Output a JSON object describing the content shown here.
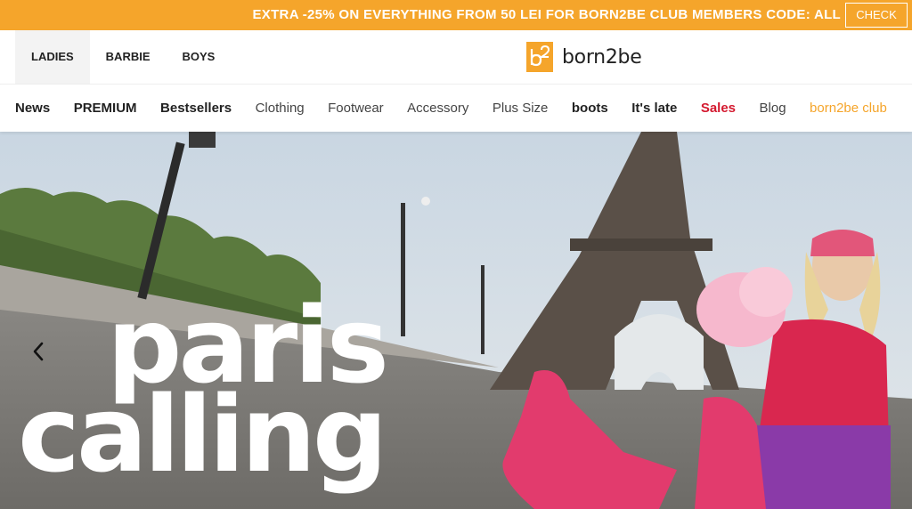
{
  "promo": {
    "text": "EXTRA -25% ON EVERYTHING FROM 50 LEI FOR BORN2BE CLUB MEMBERS CODE: ALL",
    "button_label": "CHECK",
    "color": "#f5a52b"
  },
  "header": {
    "gender_tabs": [
      {
        "label": "LADIES",
        "active": true
      },
      {
        "label": "BARBIE",
        "active": false
      },
      {
        "label": "BOYS",
        "active": false
      }
    ],
    "logo_text": "born2be"
  },
  "nav": {
    "items": [
      {
        "label": "News"
      },
      {
        "label": "PREMIUM"
      },
      {
        "label": "Bestsellers"
      },
      {
        "label": "Clothing"
      },
      {
        "label": "Footwear"
      },
      {
        "label": "Accessory"
      },
      {
        "label": "Plus Size"
      },
      {
        "label": "boots"
      },
      {
        "label": "It's late"
      },
      {
        "label": "Sales"
      },
      {
        "label": "Blog"
      },
      {
        "label": "born2be club"
      }
    ],
    "sale_color": "#d4192f",
    "club_color": "#f5a52b"
  },
  "hero": {
    "title_line1": "paris",
    "title_line2": "calling",
    "prev_icon": "chevron-left-icon"
  }
}
